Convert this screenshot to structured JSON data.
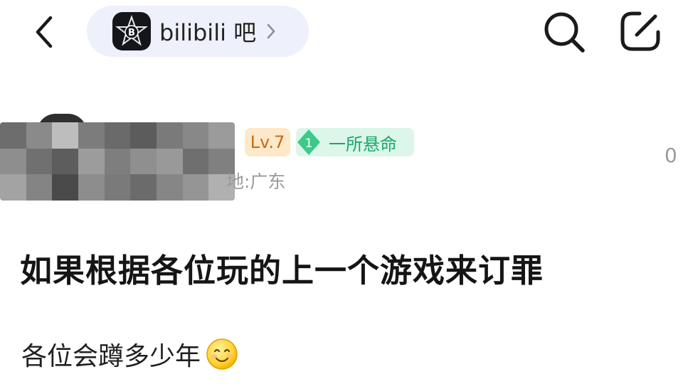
{
  "topbar": {
    "forum_name": "bilibili 吧",
    "forum_logo_text": "B",
    "back_icon": "chevron-left-icon",
    "search_icon": "search-icon",
    "compose_icon": "compose-edit-icon"
  },
  "author": {
    "level": "Lv.7",
    "title_rank": "1",
    "title_name": "一所悬命",
    "location_fragment": "地:广东",
    "side_count": "0",
    "name_hidden": true
  },
  "post": {
    "title": "如果根据各位玩的上一个游戏来订罪",
    "body": "各位会蹲多少年",
    "emoji": "smiling-face-emoji"
  },
  "colors": {
    "pill_bg": "#eef0fb",
    "level_bg": "#fde9c9",
    "level_text": "#c76a12",
    "title_bg": "#dcf6e9",
    "title_text": "#17a86a",
    "muted_text": "#9a9a9a"
  }
}
